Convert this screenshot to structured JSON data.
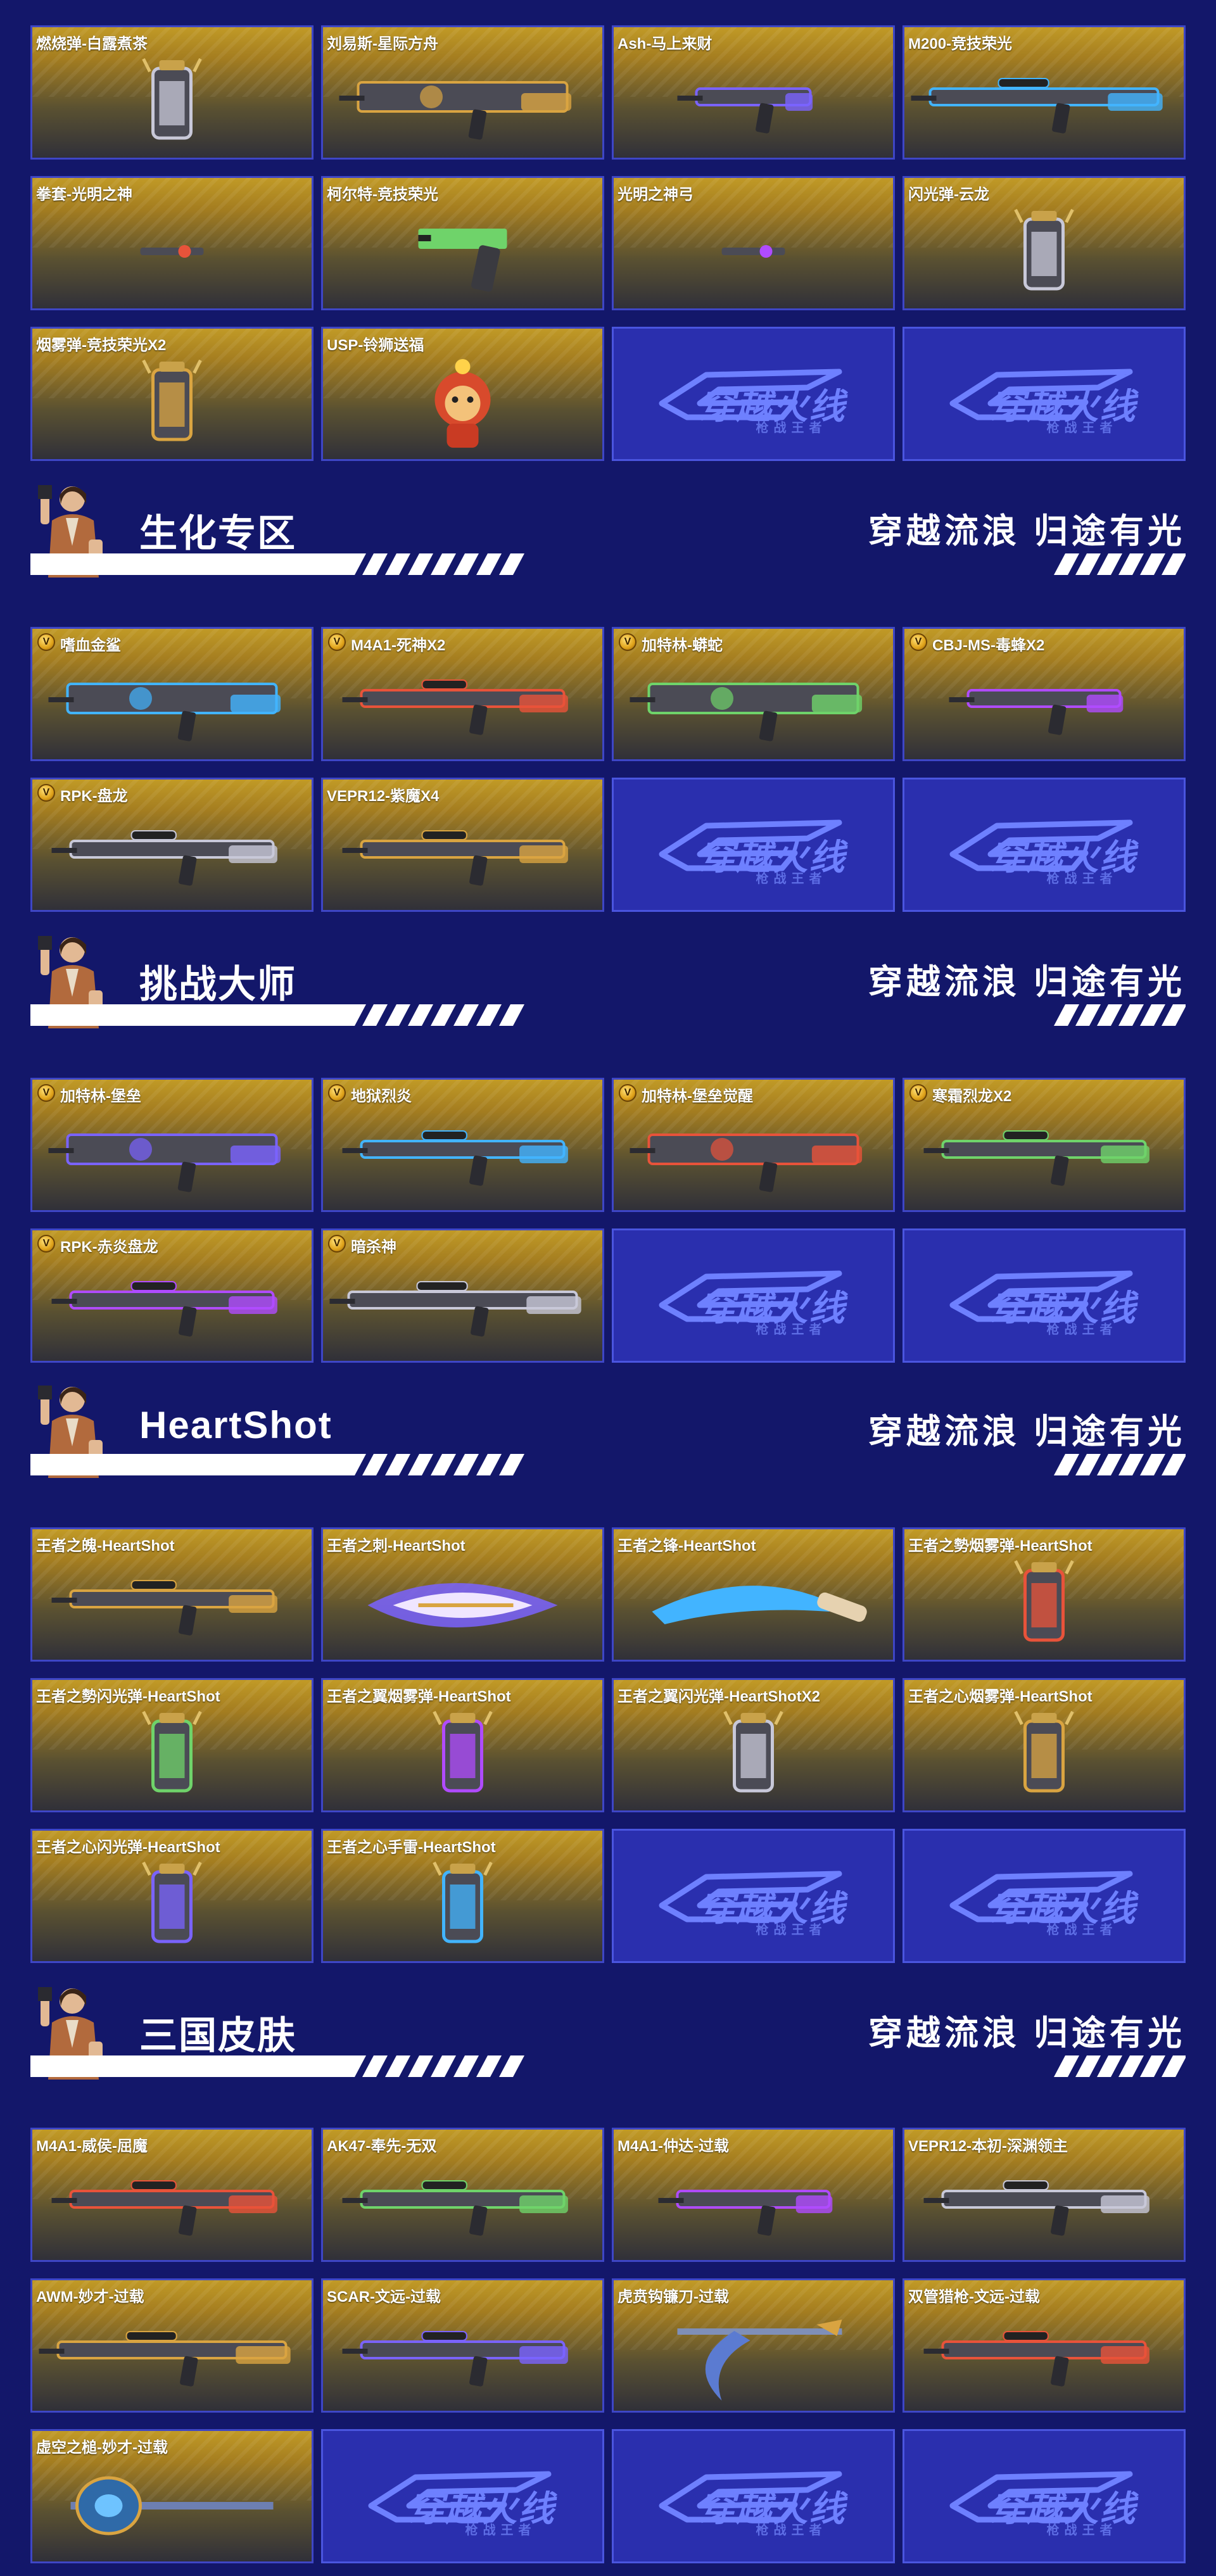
{
  "sections": [
    {
      "header": null,
      "items": [
        {
          "name": "燃烧弹-白露煮茶",
          "type": "item",
          "v": false,
          "art": "canister"
        },
        {
          "name": "刘易斯-星际方舟",
          "type": "item",
          "v": false,
          "art": "gun-heavy"
        },
        {
          "name": "Ash-马上来财",
          "type": "item",
          "v": false,
          "art": "gun-small"
        },
        {
          "name": "M200-竞技荣光",
          "type": "item",
          "v": false,
          "art": "rifle-sniper"
        },
        {
          "name": "拳套-光明之神",
          "type": "item",
          "v": false,
          "art": "tiny"
        },
        {
          "name": "柯尔特-竞技荣光",
          "type": "item",
          "v": false,
          "art": "pistol"
        },
        {
          "name": "光明之神弓",
          "type": "item",
          "v": false,
          "art": "tiny"
        },
        {
          "name": "闪光弹-云龙",
          "type": "item",
          "v": false,
          "art": "canister"
        },
        {
          "name": "烟雾弹-竞技荣光X2",
          "type": "item",
          "v": false,
          "art": "canister"
        },
        {
          "name": "USP-铃狮送福",
          "type": "item",
          "v": false,
          "art": "lion"
        },
        {
          "type": "logo"
        },
        {
          "type": "logo"
        }
      ]
    },
    {
      "header": {
        "title": "生化专区",
        "slogan": "穿越流浪 归途有光"
      },
      "items": [
        {
          "name": "嗜血金鲨",
          "type": "item",
          "v": true,
          "art": "gun-heavy"
        },
        {
          "name": "M4A1-死神X2",
          "type": "item",
          "v": true,
          "art": "rifle"
        },
        {
          "name": "加特林-蟒蛇",
          "type": "item",
          "v": true,
          "art": "gun-heavy"
        },
        {
          "name": "CBJ-MS-毒蜂X2",
          "type": "item",
          "v": true,
          "art": "smg"
        },
        {
          "name": "RPK-盘龙",
          "type": "item",
          "v": true,
          "art": "rifle"
        },
        {
          "name": "VEPR12-紫魔X4",
          "type": "item",
          "v": false,
          "art": "rifle"
        },
        {
          "type": "logo"
        },
        {
          "type": "logo"
        }
      ]
    },
    {
      "header": {
        "title": "挑战大师",
        "slogan": "穿越流浪 归途有光"
      },
      "items": [
        {
          "name": "加特林-堡垒",
          "type": "item",
          "v": true,
          "art": "gun-heavy"
        },
        {
          "name": "地狱烈炎",
          "type": "item",
          "v": true,
          "art": "rifle"
        },
        {
          "name": "加特林-堡垒觉醒",
          "type": "item",
          "v": true,
          "art": "gun-heavy"
        },
        {
          "name": "寒霜烈龙X2",
          "type": "item",
          "v": true,
          "art": "rifle"
        },
        {
          "name": "RPK-赤炎盘龙",
          "type": "item",
          "v": true,
          "art": "rifle"
        },
        {
          "name": "暗杀神",
          "type": "item",
          "v": true,
          "art": "rifle-sniper"
        },
        {
          "type": "logo"
        },
        {
          "type": "logo"
        }
      ]
    },
    {
      "header": {
        "title": "HeartShot",
        "slogan": "穿越流浪 归途有光"
      },
      "items": [
        {
          "name": "王者之魄-HeartShot",
          "type": "item",
          "v": false,
          "art": "rifle"
        },
        {
          "name": "王者之刺-HeartShot",
          "type": "item",
          "v": false,
          "art": "blade"
        },
        {
          "name": "王者之锋-HeartShot",
          "type": "item",
          "v": false,
          "art": "knife"
        },
        {
          "name": "王者之勢烟雾弹-HeartShot",
          "type": "item",
          "v": false,
          "art": "canister"
        },
        {
          "name": "王者之勢闪光弹-HeartShot",
          "type": "item",
          "v": false,
          "art": "canister"
        },
        {
          "name": "王者之翼烟雾弹-HeartShot",
          "type": "item",
          "v": false,
          "art": "canister"
        },
        {
          "name": "王者之翼闪光弹-HeartShotX2",
          "type": "item",
          "v": false,
          "art": "canister"
        },
        {
          "name": "王者之心烟雾弹-HeartShot",
          "type": "item",
          "v": false,
          "art": "canister"
        },
        {
          "name": "王者之心闪光弹-HeartShot",
          "type": "item",
          "v": false,
          "art": "canister"
        },
        {
          "name": "王者之心手雷-HeartShot",
          "type": "item",
          "v": false,
          "art": "canister"
        },
        {
          "type": "logo"
        },
        {
          "type": "logo"
        }
      ]
    },
    {
      "header": {
        "title": "三国皮肤",
        "slogan": "穿越流浪 归途有光"
      },
      "items": [
        {
          "name": "M4A1-威侯-屈魔",
          "type": "item",
          "v": false,
          "art": "rifle"
        },
        {
          "name": "AK47-奉先-无双",
          "type": "item",
          "v": false,
          "art": "rifle"
        },
        {
          "name": "M4A1-仲达-过载",
          "type": "item",
          "v": false,
          "art": "smg"
        },
        {
          "name": "VEPR12-本初-深渊领主",
          "type": "item",
          "v": false,
          "art": "rifle"
        },
        {
          "name": "AWM-妙才-过载",
          "type": "item",
          "v": false,
          "art": "rifle-sniper"
        },
        {
          "name": "SCAR-文远-过载",
          "type": "item",
          "v": false,
          "art": "rifle"
        },
        {
          "name": "虎贲钩镰刀-过载",
          "type": "item",
          "v": false,
          "art": "scythe"
        },
        {
          "name": "双管猎枪-文远-过载",
          "type": "item",
          "v": false,
          "art": "rifle"
        },
        {
          "name": "虚空之槌-妙才-过载",
          "type": "item",
          "v": false,
          "art": "hammer"
        },
        {
          "type": "logo"
        },
        {
          "type": "logo"
        },
        {
          "type": "logo"
        }
      ]
    }
  ],
  "logo": {
    "main": "穿越火线",
    "sub": "枪战王者"
  },
  "colors": {
    "background": "#13176a",
    "card_gold": "#c19a26",
    "card_dark": "#303039",
    "logo_panel": "#2a2fae",
    "border": "#3e46c6"
  }
}
